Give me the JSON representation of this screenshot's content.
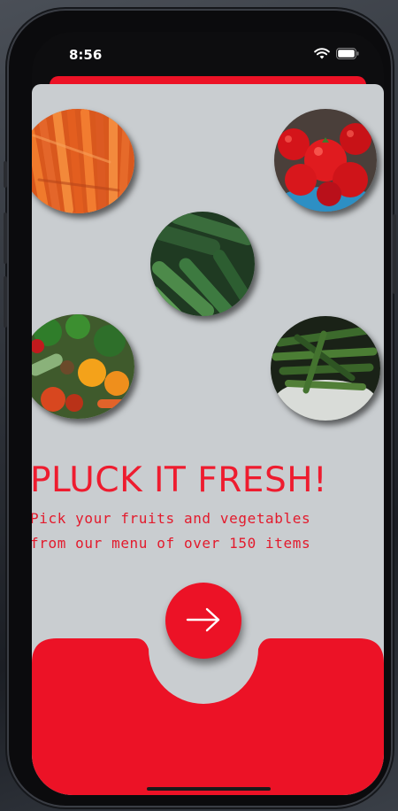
{
  "status_bar": {
    "time": "8:56",
    "icons": [
      "wifi-icon",
      "battery-icon"
    ]
  },
  "onboarding": {
    "images": [
      {
        "name": "carrots-image",
        "depicts": "carrots"
      },
      {
        "name": "tomatoes-image",
        "depicts": "tomatoes"
      },
      {
        "name": "cucumbers-image",
        "depicts": "cucumbers"
      },
      {
        "name": "mixed-vegetables-image",
        "depicts": "mixed vegetables"
      },
      {
        "name": "okra-image",
        "depicts": "okra"
      }
    ],
    "headline": "PLUCK IT FRESH!",
    "subtitle_line1": "Pick your fruits and vegetables",
    "subtitle_line2": "from our menu of over 150 items",
    "next_icon": "arrow-right-icon"
  },
  "colors": {
    "accent": "#ec1226",
    "background": "#c9cdd0",
    "headline": "#ee1c2f"
  }
}
